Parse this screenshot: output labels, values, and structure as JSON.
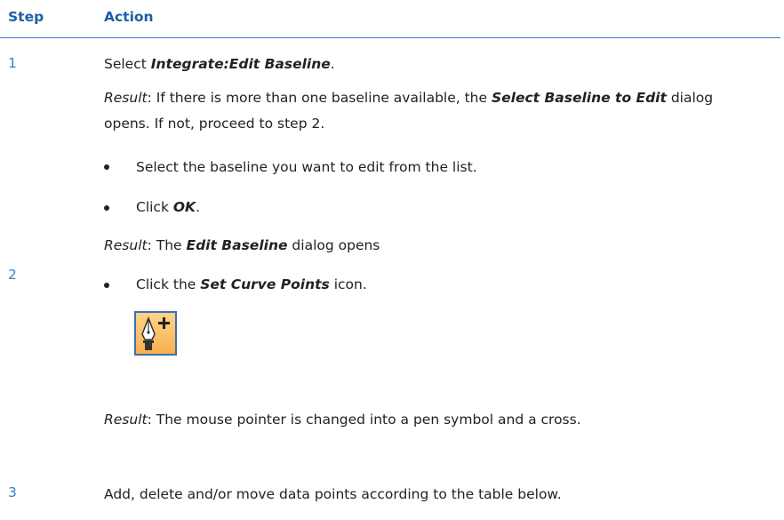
{
  "header": {
    "step": "Step",
    "action": "Action"
  },
  "steps": [
    {
      "number": "1",
      "select_prefix": "Select ",
      "select_target": "Integrate:Edit Baseline",
      "select_suffix": ".",
      "result1_label": "Result",
      "result1_a": ": If there is more than one baseline available, the ",
      "result1_dialog": "Select Baseline to Edit",
      "result1_b": " dialog opens. If not, proceed to step 2.",
      "bullet1": "Select the baseline you want to edit from the list.",
      "bullet2_prefix": "Click ",
      "bullet2_target": "OK",
      "bullet2_suffix": ".",
      "result2_label": "Result",
      "result2_a": ": The ",
      "result2_dialog": "Edit Baseline",
      "result2_b": " dialog opens"
    },
    {
      "number": "2",
      "bullet_prefix": "Click the ",
      "bullet_target": "Set Curve Points",
      "bullet_suffix": " icon.",
      "icon": "set-curve-points-icon",
      "result_label": "Result",
      "result_text": ": The mouse pointer is changed into a pen symbol and a cross."
    },
    {
      "number": "3",
      "text": "Add, delete and/or move data points according to the table below."
    }
  ],
  "colors": {
    "heading": "#1f5ea3",
    "rule": "#3c7fc0",
    "step_number": "#3e80c7",
    "icon_bg": "#f7b04c",
    "icon_border": "#3f6fb6"
  }
}
